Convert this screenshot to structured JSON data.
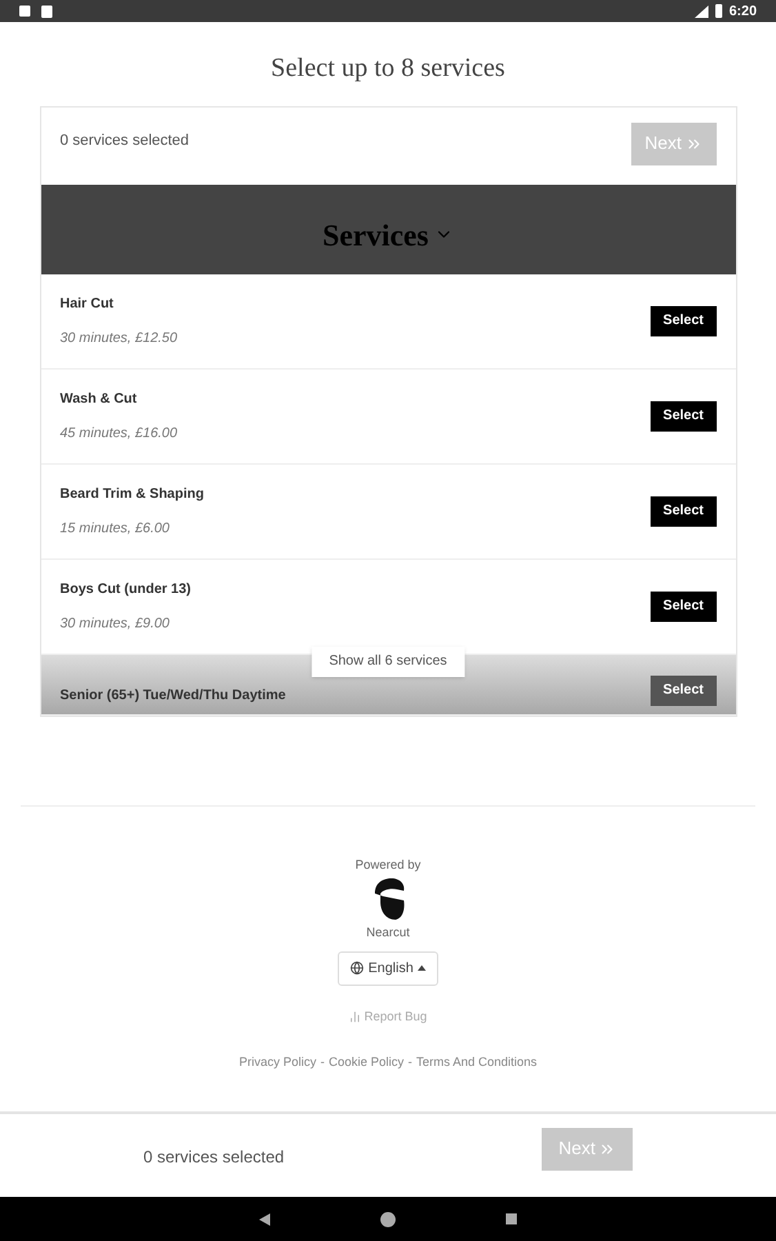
{
  "status_bar": {
    "time": "6:20"
  },
  "title": "Select up to 8 services",
  "summary": {
    "count_text": "0 services selected",
    "next_button": {
      "label": "Next",
      "disabled": true
    }
  },
  "category": {
    "title": "Services",
    "expanded": true
  },
  "services": [
    {
      "name": "Hair Cut",
      "details": "30 minutes, £12.50",
      "button": "Select",
      "faded": false
    },
    {
      "name": "Wash & Cut",
      "details": "45 minutes, £16.00",
      "button": "Select",
      "faded": false
    },
    {
      "name": "Beard Trim & Shaping",
      "details": "15 minutes, £6.00",
      "button": "Select",
      "faded": false
    },
    {
      "name": "Boys Cut (under 13)",
      "details": "30 minutes, £9.00",
      "button": "Select",
      "faded": false
    },
    {
      "name": "Senior (65+) Tue/Wed/Thu Daytime",
      "button": "Select",
      "faded": true
    }
  ],
  "show_all_button": "Show all 6 services",
  "footer": {
    "powered_by": "Powered by",
    "brand": "Nearcut",
    "language": "English",
    "report_bug": "Report Bug",
    "links": [
      "Privacy Policy",
      "Cookie Policy",
      "Terms And Conditions"
    ],
    "separator": "-"
  },
  "bottom_bar": {
    "count_text": "0 services selected",
    "next_button": {
      "label": "Next",
      "disabled": true
    }
  }
}
